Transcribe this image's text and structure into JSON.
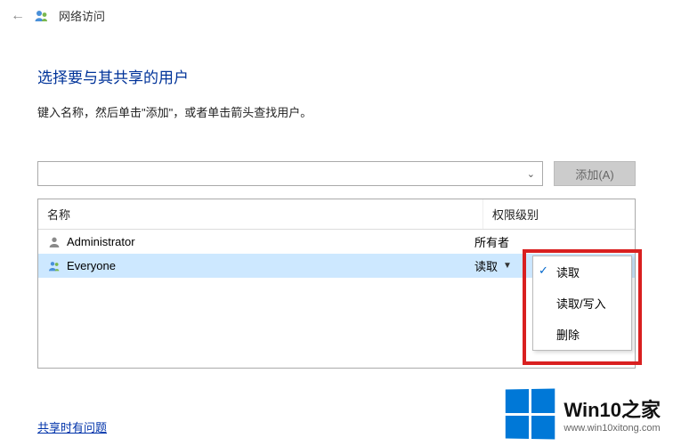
{
  "titlebar": {
    "title": "网络访问"
  },
  "heading": "选择要与其共享的用户",
  "instruction": "键入名称，然后单击\"添加\"，或者单击箭头查找用户。",
  "combo": {
    "value": ""
  },
  "addButton": "添加(A)",
  "table": {
    "headers": {
      "name": "名称",
      "perm": "权限级别"
    },
    "rows": [
      {
        "name": "Administrator",
        "perm": "所有者",
        "selected": false,
        "hasChevron": false
      },
      {
        "name": "Everyone",
        "perm": "读取",
        "selected": true,
        "hasChevron": true
      }
    ]
  },
  "contextMenu": {
    "items": [
      {
        "label": "读取",
        "checked": true
      },
      {
        "label": "读取/写入",
        "checked": false
      },
      {
        "label": "删除",
        "checked": false
      }
    ]
  },
  "footerLink": "共享时有问题",
  "watermark": {
    "big": "Win10之家",
    "small": "www.win10xitong.com"
  }
}
